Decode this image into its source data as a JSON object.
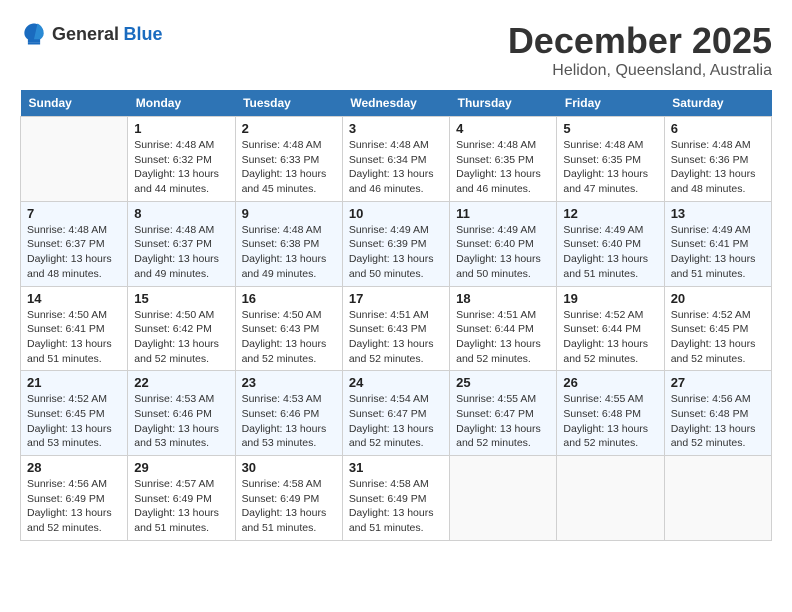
{
  "logo": {
    "general": "General",
    "blue": "Blue"
  },
  "title": "December 2025",
  "location": "Helidon, Queensland, Australia",
  "days_header": [
    "Sunday",
    "Monday",
    "Tuesday",
    "Wednesday",
    "Thursday",
    "Friday",
    "Saturday"
  ],
  "weeks": [
    [
      {
        "day": "",
        "info": ""
      },
      {
        "day": "1",
        "info": "Sunrise: 4:48 AM\nSunset: 6:32 PM\nDaylight: 13 hours\nand 44 minutes."
      },
      {
        "day": "2",
        "info": "Sunrise: 4:48 AM\nSunset: 6:33 PM\nDaylight: 13 hours\nand 45 minutes."
      },
      {
        "day": "3",
        "info": "Sunrise: 4:48 AM\nSunset: 6:34 PM\nDaylight: 13 hours\nand 46 minutes."
      },
      {
        "day": "4",
        "info": "Sunrise: 4:48 AM\nSunset: 6:35 PM\nDaylight: 13 hours\nand 46 minutes."
      },
      {
        "day": "5",
        "info": "Sunrise: 4:48 AM\nSunset: 6:35 PM\nDaylight: 13 hours\nand 47 minutes."
      },
      {
        "day": "6",
        "info": "Sunrise: 4:48 AM\nSunset: 6:36 PM\nDaylight: 13 hours\nand 48 minutes."
      }
    ],
    [
      {
        "day": "7",
        "info": "Sunrise: 4:48 AM\nSunset: 6:37 PM\nDaylight: 13 hours\nand 48 minutes."
      },
      {
        "day": "8",
        "info": "Sunrise: 4:48 AM\nSunset: 6:37 PM\nDaylight: 13 hours\nand 49 minutes."
      },
      {
        "day": "9",
        "info": "Sunrise: 4:48 AM\nSunset: 6:38 PM\nDaylight: 13 hours\nand 49 minutes."
      },
      {
        "day": "10",
        "info": "Sunrise: 4:49 AM\nSunset: 6:39 PM\nDaylight: 13 hours\nand 50 minutes."
      },
      {
        "day": "11",
        "info": "Sunrise: 4:49 AM\nSunset: 6:40 PM\nDaylight: 13 hours\nand 50 minutes."
      },
      {
        "day": "12",
        "info": "Sunrise: 4:49 AM\nSunset: 6:40 PM\nDaylight: 13 hours\nand 51 minutes."
      },
      {
        "day": "13",
        "info": "Sunrise: 4:49 AM\nSunset: 6:41 PM\nDaylight: 13 hours\nand 51 minutes."
      }
    ],
    [
      {
        "day": "14",
        "info": "Sunrise: 4:50 AM\nSunset: 6:41 PM\nDaylight: 13 hours\nand 51 minutes."
      },
      {
        "day": "15",
        "info": "Sunrise: 4:50 AM\nSunset: 6:42 PM\nDaylight: 13 hours\nand 52 minutes."
      },
      {
        "day": "16",
        "info": "Sunrise: 4:50 AM\nSunset: 6:43 PM\nDaylight: 13 hours\nand 52 minutes."
      },
      {
        "day": "17",
        "info": "Sunrise: 4:51 AM\nSunset: 6:43 PM\nDaylight: 13 hours\nand 52 minutes."
      },
      {
        "day": "18",
        "info": "Sunrise: 4:51 AM\nSunset: 6:44 PM\nDaylight: 13 hours\nand 52 minutes."
      },
      {
        "day": "19",
        "info": "Sunrise: 4:52 AM\nSunset: 6:44 PM\nDaylight: 13 hours\nand 52 minutes."
      },
      {
        "day": "20",
        "info": "Sunrise: 4:52 AM\nSunset: 6:45 PM\nDaylight: 13 hours\nand 52 minutes."
      }
    ],
    [
      {
        "day": "21",
        "info": "Sunrise: 4:52 AM\nSunset: 6:45 PM\nDaylight: 13 hours\nand 53 minutes."
      },
      {
        "day": "22",
        "info": "Sunrise: 4:53 AM\nSunset: 6:46 PM\nDaylight: 13 hours\nand 53 minutes."
      },
      {
        "day": "23",
        "info": "Sunrise: 4:53 AM\nSunset: 6:46 PM\nDaylight: 13 hours\nand 53 minutes."
      },
      {
        "day": "24",
        "info": "Sunrise: 4:54 AM\nSunset: 6:47 PM\nDaylight: 13 hours\nand 52 minutes."
      },
      {
        "day": "25",
        "info": "Sunrise: 4:55 AM\nSunset: 6:47 PM\nDaylight: 13 hours\nand 52 minutes."
      },
      {
        "day": "26",
        "info": "Sunrise: 4:55 AM\nSunset: 6:48 PM\nDaylight: 13 hours\nand 52 minutes."
      },
      {
        "day": "27",
        "info": "Sunrise: 4:56 AM\nSunset: 6:48 PM\nDaylight: 13 hours\nand 52 minutes."
      }
    ],
    [
      {
        "day": "28",
        "info": "Sunrise: 4:56 AM\nSunset: 6:49 PM\nDaylight: 13 hours\nand 52 minutes."
      },
      {
        "day": "29",
        "info": "Sunrise: 4:57 AM\nSunset: 6:49 PM\nDaylight: 13 hours\nand 51 minutes."
      },
      {
        "day": "30",
        "info": "Sunrise: 4:58 AM\nSunset: 6:49 PM\nDaylight: 13 hours\nand 51 minutes."
      },
      {
        "day": "31",
        "info": "Sunrise: 4:58 AM\nSunset: 6:49 PM\nDaylight: 13 hours\nand 51 minutes."
      },
      {
        "day": "",
        "info": ""
      },
      {
        "day": "",
        "info": ""
      },
      {
        "day": "",
        "info": ""
      }
    ]
  ]
}
